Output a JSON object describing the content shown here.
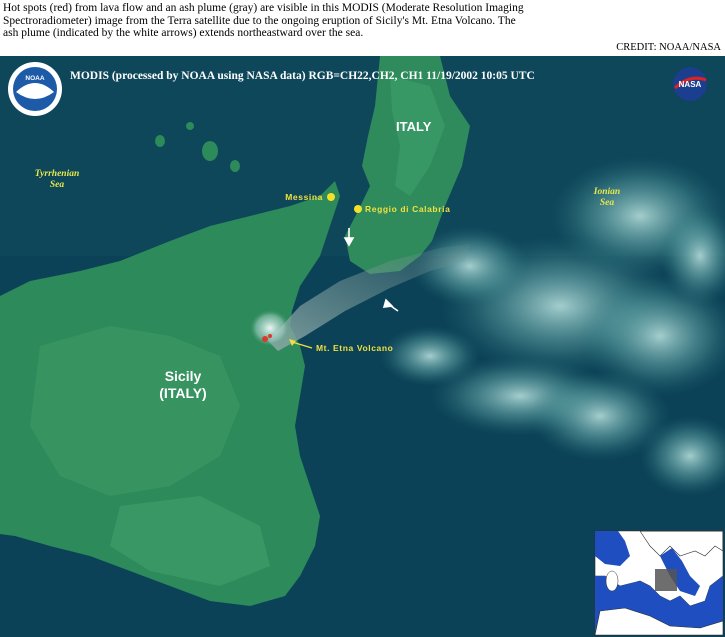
{
  "caption": {
    "lines": [
      "Hot spots (red) from lava flow and an ash plume (gray) are visible in this MODIS (Moderate Resolution Imaging",
      "Spectroradiometer) image from the Terra satellite due to the ongoing eruption of Sicily's Mt. Etna Volcano.  The",
      "ash plume (indicated by the white arrows) extends northeastward over the sea."
    ],
    "credit": "CREDIT: NOAA/NASA"
  },
  "map": {
    "header": "MODIS  (processed by NOAA using NASA data)  RGB=CH22,CH2, CH1  11/19/2002  10:05 UTC",
    "logos": {
      "left": "NOAA",
      "right": "NASA"
    },
    "labels": {
      "italy": "ITALY",
      "sicily_line1": "Sicily",
      "sicily_line2": "(ITALY)",
      "tyrrhenian_line1": "Tyrrhenian",
      "tyrrhenian_line2": "Sea",
      "ionian_line1": "Ionian",
      "ionian_line2": "Sea",
      "messina": "Messina",
      "reggio": "Reggio di Calabria",
      "etna": "Mt. Etna Volcano"
    },
    "colors": {
      "sea": "#0c4257",
      "land": "#2d8a5a",
      "city_marker": "#f5e02a",
      "hot_spot": "#d93a2a",
      "plume": "#7b9a9a"
    }
  }
}
